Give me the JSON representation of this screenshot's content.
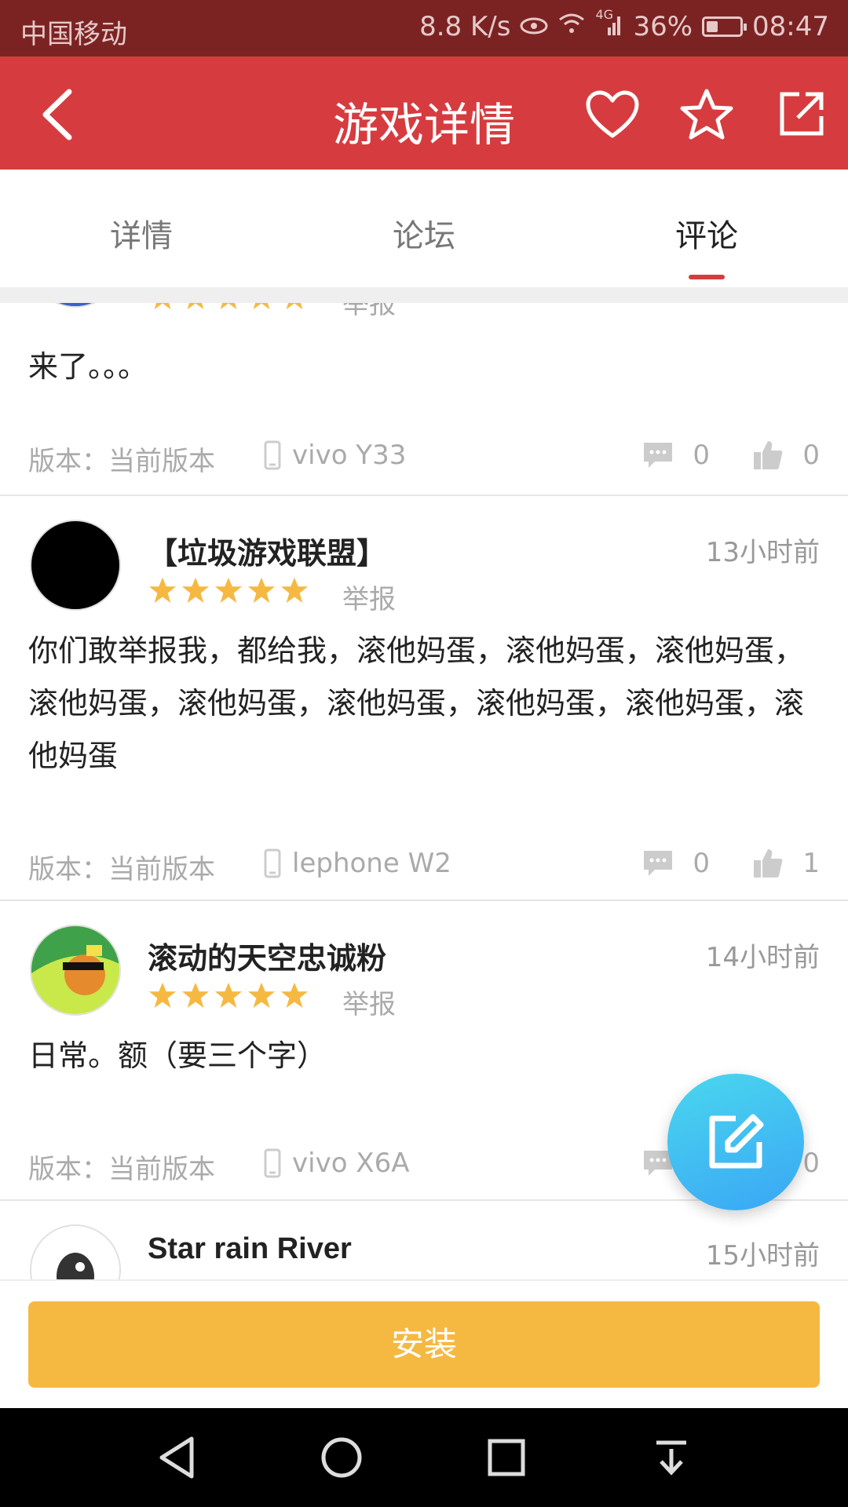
{
  "status_bar": {
    "carrier": "中国移动",
    "speed": "8.8 K/s",
    "network": "4G",
    "battery": "36%",
    "battery_level": 0.36,
    "time": "08:47"
  },
  "header": {
    "title": "游戏详情",
    "icons": [
      "back-icon",
      "heart-icon",
      "star-icon",
      "share-icon"
    ]
  },
  "tabs": [
    {
      "label": "详情",
      "active": false
    },
    {
      "label": "论坛",
      "active": false
    },
    {
      "label": "评论",
      "active": true
    }
  ],
  "comments": [
    {
      "username": "",
      "time": "",
      "rating": 5,
      "report_label": "举报",
      "text": "来了。。。",
      "version": "版本：当前版本",
      "device": "vivo Y33",
      "comment_count": "0",
      "like_count": "0"
    },
    {
      "username": "【垃圾游戏联盟】",
      "time": "13小时前",
      "rating": 5,
      "report_label": "举报",
      "text": "你们敢举报我，都给我，滚他妈蛋，滚他妈蛋，滚他妈蛋，滚他妈蛋，滚他妈蛋，滚他妈蛋，滚他妈蛋，滚他妈蛋，滚他妈蛋",
      "version": "版本：当前版本",
      "device": "lephone W2",
      "comment_count": "0",
      "like_count": "1"
    },
    {
      "username": "滚动的天空忠诚粉",
      "time": "14小时前",
      "rating": 5,
      "report_label": "举报",
      "text": "日常。额（要三个字）",
      "version": "版本：当前版本",
      "device": "vivo X6A",
      "comment_count": "0",
      "like_count": "0"
    },
    {
      "username": "Star rain River",
      "time": "15小时前"
    }
  ],
  "install_button": "安装",
  "colors": {
    "header": "#d63c3f",
    "status_bar": "#7b2323",
    "install": "#f5b942",
    "star": "#f5b942",
    "fab": "#3fc2f2"
  }
}
